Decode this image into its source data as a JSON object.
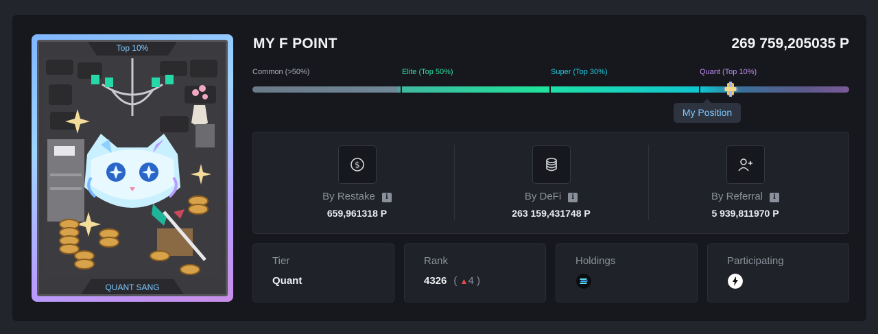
{
  "card": {
    "top_label": "Top 10%",
    "name": "QUANT SANG"
  },
  "header": {
    "title": "MY F POINT",
    "total": "269 759,205035 P"
  },
  "tiers": [
    {
      "label": "Common (>50%)",
      "color": "#aab0b8"
    },
    {
      "label": "Elite (Top 50%)",
      "color": "#2fe0a0"
    },
    {
      "label": "Super (Top 30%)",
      "color": "#21c9e0"
    },
    {
      "label": "Quant (Top 10%)",
      "color": "#c08df0"
    }
  ],
  "position_tooltip": "My Position",
  "sources": [
    {
      "label": "By Restake",
      "value": "659,961318 P",
      "icon": "dollar-circle-icon"
    },
    {
      "label": "By DeFi",
      "value": "263 159,431748 P",
      "icon": "database-icon"
    },
    {
      "label": "By Referral",
      "value": "5 939,811970 P",
      "icon": "user-plus-icon"
    }
  ],
  "info_glyph": "i",
  "stats": {
    "tier": {
      "label": "Tier",
      "value": "Quant"
    },
    "rank": {
      "label": "Rank",
      "value": "4326",
      "change_open": "(",
      "change_arrow": "▲",
      "change": "4",
      "change_close": ")"
    },
    "holdings": {
      "label": "Holdings",
      "icon": "token-logo-icon"
    },
    "participating": {
      "label": "Participating",
      "icon": "protocol-logo-icon"
    }
  }
}
